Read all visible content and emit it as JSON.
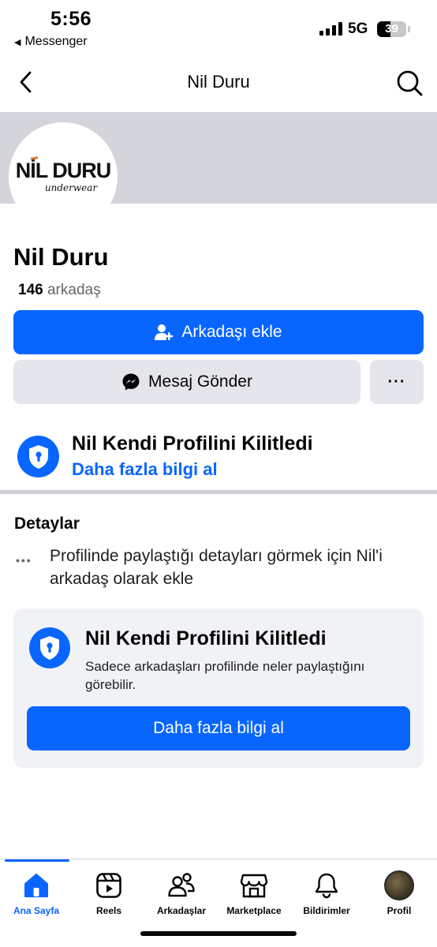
{
  "status": {
    "time": "5:56",
    "back_app": "Messenger",
    "network": "5G",
    "battery": "39",
    "battery_level": 0.39
  },
  "nav": {
    "title": "Nil Duru"
  },
  "profile": {
    "logo_main": "NİL DURU",
    "logo_sub": "underwear",
    "name": "Nil Duru",
    "friends_count": "146",
    "friends_label": "arkadaş"
  },
  "actions": {
    "add_friend": "Arkadaşı ekle",
    "message": "Mesaj Gönder",
    "more": "···"
  },
  "lock_notice": {
    "title": "Nil Kendi Profilini Kilitledi",
    "link": "Daha fazla bilgi al"
  },
  "details": {
    "title": "Detaylar",
    "dots": "•••",
    "text": "Profilinde paylaştığı detayları görmek için Nil'i arkadaş olarak ekle"
  },
  "lock_card": {
    "title": "Nil Kendi Profilini Kilitledi",
    "text": "Sadece arkadaşları profilinde neler paylaştığını görebilir.",
    "button": "Daha fazla bilgi al"
  },
  "tabs": [
    {
      "label": "Ana Sayfa",
      "icon": "home-icon",
      "active": true
    },
    {
      "label": "Reels",
      "icon": "reels-icon",
      "active": false
    },
    {
      "label": "Arkadaşlar",
      "icon": "friends-icon",
      "active": false
    },
    {
      "label": "Marketplace",
      "icon": "marketplace-icon",
      "active": false
    },
    {
      "label": "Bildirimler",
      "icon": "bell-icon",
      "active": false
    },
    {
      "label": "Profil",
      "icon": "profile-avatar",
      "active": false
    }
  ],
  "colors": {
    "accent": "#0866ff",
    "secondary_button": "#e4e6eb",
    "cover": "#d3d5da",
    "card_bg": "#f0f2f5"
  }
}
